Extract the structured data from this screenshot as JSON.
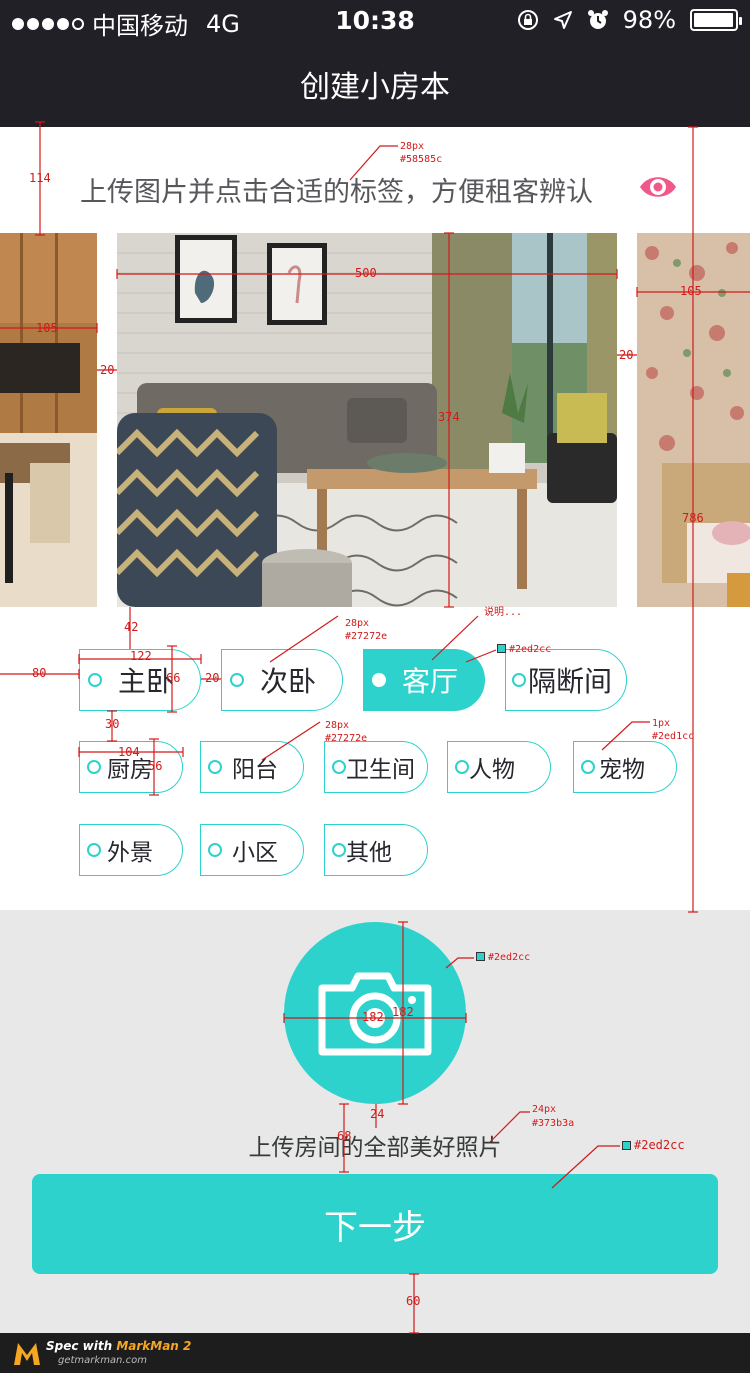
{
  "status_bar": {
    "carrier": "中国移动",
    "network": "4G",
    "time": "10:38",
    "battery": "98%",
    "battery_level": 0.98,
    "signal_bars": 4,
    "icons": [
      "orientation-lock-icon",
      "location-arrow-icon",
      "alarm-icon",
      "battery-icon"
    ]
  },
  "nav": {
    "title": "创建小房本"
  },
  "hint": {
    "text": "上传图片并点击合适的标签，方便租客辨认",
    "icon": "eye-icon"
  },
  "tags_row1": [
    {
      "label": "主卧",
      "active": false
    },
    {
      "label": "次卧",
      "active": false
    },
    {
      "label": "客厅",
      "active": true
    },
    {
      "label": "隔断间",
      "active": false
    }
  ],
  "tags_row2": [
    {
      "label": "厨房"
    },
    {
      "label": "阳台"
    },
    {
      "label": "卫生间"
    },
    {
      "label": "人物"
    },
    {
      "label": "宠物"
    }
  ],
  "tags_row3": [
    {
      "label": "外景"
    },
    {
      "label": "小区"
    },
    {
      "label": "其他"
    }
  ],
  "upload": {
    "text": "上传房间的全部美好照片",
    "icon": "camera-icon"
  },
  "next_button": {
    "label": "下一步"
  },
  "colors": {
    "accent": "#2ed2cc",
    "nav_bg": "#212026",
    "hint_text": "#58585c",
    "tag_text": "#27272e",
    "upload_text": "#373b3a",
    "eye": "#f0588a"
  },
  "spec": {
    "m114": "114",
    "hint_size": "28px",
    "hint_color": "#58585c",
    "photo_w": "500",
    "photo_h": "374",
    "m20a": "20",
    "m20b": "20",
    "m105a": "105",
    "m105b": "105",
    "m786": "786",
    "m42": "42",
    "m122": "122",
    "m66": "66",
    "m20c": "20",
    "m80": "80",
    "m30": "30",
    "m104": "104",
    "m56": "56",
    "tag_size": "28px",
    "tag_color": "#27272e",
    "note": "说明...",
    "active_color": "#2ed2cc",
    "small_size": "28px",
    "small_color": "#27272e",
    "border_w": "1px",
    "border_color": "#2ed1cc",
    "camera_color": "#2ed2cc",
    "camera_w": "182",
    "camera_h": "182",
    "m24": "24",
    "m68": "68",
    "upload_size": "24px",
    "upload_color": "#373b3a",
    "button_color": "#2ed2cc",
    "m60": "60"
  },
  "footer": {
    "brand_prefix": "Spec with ",
    "brand": "MarkMan 2",
    "url": "getmarkman.com"
  }
}
